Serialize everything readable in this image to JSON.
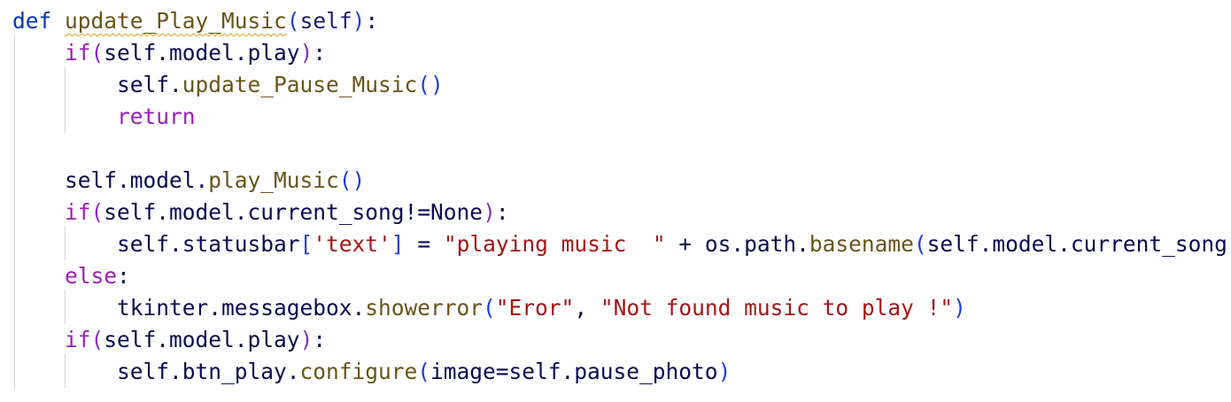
{
  "editor": {
    "lines": [
      {
        "tokens": [
          {
            "t": "def",
            "c": "kw"
          },
          {
            "t": " "
          },
          {
            "t": "update_Play_Music",
            "c": "fn",
            "squiggle": true
          },
          {
            "t": "(",
            "c": "p1"
          },
          {
            "t": "self",
            "c": "self"
          },
          {
            "t": ")",
            "c": "p1"
          },
          {
            "t": ":"
          }
        ]
      },
      {
        "tokens": [
          {
            "t": "    "
          },
          {
            "t": "if",
            "c": "kw2"
          },
          {
            "t": "(",
            "c": "p2"
          },
          {
            "t": "self.model.play"
          },
          {
            "t": ")",
            "c": "p2"
          },
          {
            "t": ":"
          }
        ]
      },
      {
        "tokens": [
          {
            "t": "        self."
          },
          {
            "t": "update_Pause_Music",
            "c": "fn"
          },
          {
            "t": "()",
            "c": "p1"
          }
        ]
      },
      {
        "tokens": [
          {
            "t": "        "
          },
          {
            "t": "return",
            "c": "kw2"
          }
        ]
      },
      {
        "tokens": []
      },
      {
        "tokens": [
          {
            "t": "    self.model."
          },
          {
            "t": "play_Music",
            "c": "fn"
          },
          {
            "t": "()",
            "c": "p1"
          }
        ]
      },
      {
        "tokens": [
          {
            "t": "    "
          },
          {
            "t": "if",
            "c": "kw2"
          },
          {
            "t": "(",
            "c": "p2"
          },
          {
            "t": "self.model.current_song!=None"
          },
          {
            "t": ")",
            "c": "p2"
          },
          {
            "t": ":"
          }
        ]
      },
      {
        "tokens": [
          {
            "t": "        self.statusbar"
          },
          {
            "t": "[",
            "c": "p1"
          },
          {
            "t": "'text'",
            "c": "str"
          },
          {
            "t": "]",
            "c": "p1"
          },
          {
            "t": " = "
          },
          {
            "t": "\"playing music  \"",
            "c": "str"
          },
          {
            "t": " + os.path."
          },
          {
            "t": "basename",
            "c": "fn"
          },
          {
            "t": "(",
            "c": "p1"
          },
          {
            "t": "self.model.current_song"
          },
          {
            "t": ")",
            "c": "p1"
          }
        ]
      },
      {
        "tokens": [
          {
            "t": "    "
          },
          {
            "t": "else",
            "c": "kw2"
          },
          {
            "t": ":"
          }
        ]
      },
      {
        "tokens": [
          {
            "t": "        tkinter.messagebox."
          },
          {
            "t": "showerror",
            "c": "fn"
          },
          {
            "t": "(",
            "c": "p1"
          },
          {
            "t": "\"Eror\"",
            "c": "str"
          },
          {
            "t": ", "
          },
          {
            "t": "\"Not found music to play !\"",
            "c": "str"
          },
          {
            "t": ")",
            "c": "p1"
          }
        ]
      },
      {
        "tokens": [
          {
            "t": "    "
          },
          {
            "t": "if",
            "c": "kw2"
          },
          {
            "t": "(",
            "c": "p2"
          },
          {
            "t": "self.model.play"
          },
          {
            "t": ")",
            "c": "p2"
          },
          {
            "t": ":"
          }
        ]
      },
      {
        "tokens": [
          {
            "t": "        self.btn_play."
          },
          {
            "t": "configure",
            "c": "fn"
          },
          {
            "t": "(",
            "c": "p1"
          },
          {
            "t": "image=self.pause_photo"
          },
          {
            "t": ")",
            "c": "p1"
          }
        ]
      }
    ]
  }
}
